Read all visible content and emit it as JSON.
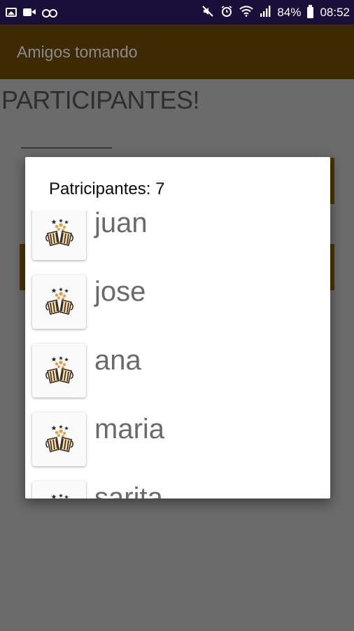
{
  "status_bar": {
    "battery": "84%",
    "time": "08:52",
    "icons": [
      "image-icon",
      "video-icon",
      "voicemail-icon",
      "mute-icon",
      "alarm-icon",
      "wifi-icon",
      "signal-icon",
      "battery-icon"
    ]
  },
  "app_bar": {
    "title": "Amigos tomando"
  },
  "page": {
    "heading": "PARTICIPANTES!"
  },
  "dialog": {
    "title": "Patricipantes: 7",
    "participants": [
      {
        "name": "juan",
        "icon": "beer-mugs-icon"
      },
      {
        "name": "jose",
        "icon": "beer-mugs-icon"
      },
      {
        "name": "ana",
        "icon": "beer-mugs-icon"
      },
      {
        "name": "maria",
        "icon": "beer-mugs-icon"
      },
      {
        "name": "sarita",
        "icon": "beer-mugs-icon"
      }
    ]
  },
  "colors": {
    "status_bar": "#1a0f38",
    "app_bar": "#3d2a05",
    "overlay_background": "#6b6b6b",
    "dialog": "#ffffff",
    "beer": "#c98a2e"
  }
}
